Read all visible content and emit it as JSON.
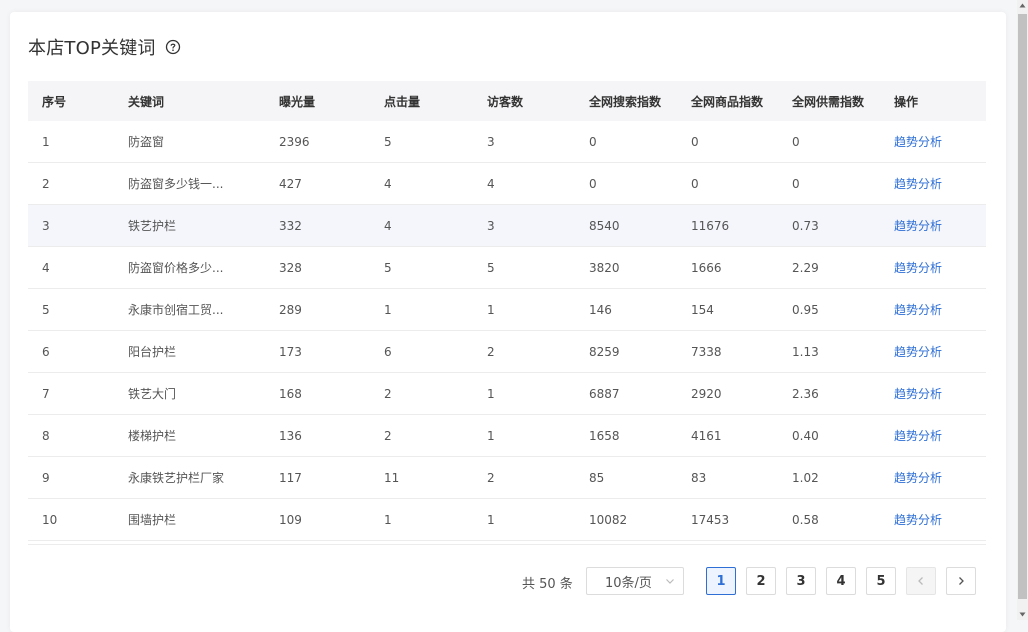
{
  "title": "本店TOP关键词",
  "table": {
    "headers": [
      "序号",
      "关键词",
      "曝光量",
      "点击量",
      "访客数",
      "全网搜索指数",
      "全网商品指数",
      "全网供需指数",
      "操作"
    ],
    "rows": [
      [
        "1",
        "防盗窗",
        "2396",
        "5",
        "3",
        "0",
        "0",
        "0",
        "趋势分析"
      ],
      [
        "2",
        "防盗窗多少钱一...",
        "427",
        "4",
        "4",
        "0",
        "0",
        "0",
        "趋势分析"
      ],
      [
        "3",
        "铁艺护栏",
        "332",
        "4",
        "3",
        "8540",
        "11676",
        "0.73",
        "趋势分析"
      ],
      [
        "4",
        "防盗窗价格多少...",
        "328",
        "5",
        "5",
        "3820",
        "1666",
        "2.29",
        "趋势分析"
      ],
      [
        "5",
        "永康市创宿工贸...",
        "289",
        "1",
        "1",
        "146",
        "154",
        "0.95",
        "趋势分析"
      ],
      [
        "6",
        "阳台护栏",
        "173",
        "6",
        "2",
        "8259",
        "7338",
        "1.13",
        "趋势分析"
      ],
      [
        "7",
        "铁艺大门",
        "168",
        "2",
        "1",
        "6887",
        "2920",
        "2.36",
        "趋势分析"
      ],
      [
        "8",
        "楼梯护栏",
        "136",
        "2",
        "1",
        "1658",
        "4161",
        "0.40",
        "趋势分析"
      ],
      [
        "9",
        "永康铁艺护栏厂家",
        "117",
        "11",
        "2",
        "85",
        "83",
        "1.02",
        "趋势分析"
      ],
      [
        "10",
        "围墙护栏",
        "109",
        "1",
        "1",
        "10082",
        "17453",
        "0.58",
        "趋势分析"
      ]
    ],
    "highlighted_row_index": 2
  },
  "pagination": {
    "total_text": "共 50 条",
    "page_size": "10条/页",
    "pages": [
      "1",
      "2",
      "3",
      "4",
      "5"
    ],
    "current_page": "1"
  },
  "colors": {
    "link": "#2e6fd6",
    "active_page": "#2e6fd6"
  },
  "icons": {
    "help": "question-circle-icon",
    "select": "chevron-down-icon",
    "prev": "chevron-left-icon",
    "next": "chevron-right-icon"
  }
}
